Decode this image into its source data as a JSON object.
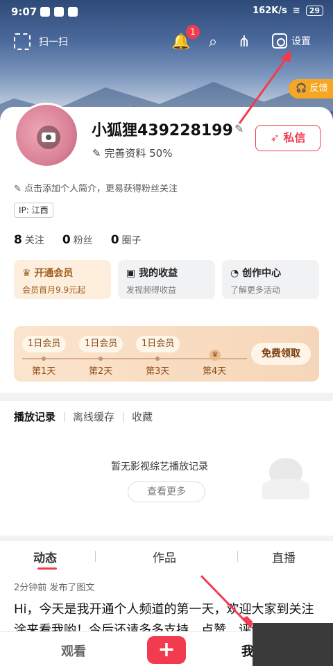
{
  "status_bar": {
    "time": "9:07",
    "network": "162K/s",
    "battery": "29"
  },
  "toolbar": {
    "scan_label": "扫一扫",
    "notification_count": "1",
    "settings_label": "设置"
  },
  "feedback_label": "反馈",
  "profile": {
    "username": "小狐狸439228199",
    "completion": "完善资料 50%",
    "bio_hint": "点击添加个人简介，更易获得粉丝关注",
    "ip": "IP: 江西",
    "message_button": "私信"
  },
  "stats": [
    {
      "count": "8",
      "label": "关注"
    },
    {
      "count": "0",
      "label": "粉丝"
    },
    {
      "count": "0",
      "label": "圈子"
    }
  ],
  "features": [
    {
      "title": "开通会员",
      "subtitle": "会员首月9.9元起"
    },
    {
      "title": "我的收益",
      "subtitle": "发视频得收益"
    },
    {
      "title": "创作中心",
      "subtitle": "了解更多活动"
    }
  ],
  "member_strip": {
    "pills": [
      "1日会员",
      "1日会员",
      "1日会员"
    ],
    "days": [
      "第1天",
      "第2天",
      "第3天",
      "第4天"
    ],
    "free_button": "免费领取"
  },
  "history": {
    "tabs": [
      "播放记录",
      "离线缓存",
      "收藏"
    ],
    "empty_text": "暂无影视综艺播放记录",
    "more_button": "查看更多"
  },
  "content_tabs": [
    "动态",
    "作品",
    "直播"
  ],
  "post": {
    "meta": "2分钟前 发布了图文",
    "text": "Hi，今天是我开通个人频道的第一天，欢迎大家到关注涂来看我哟！今后还请多多支持，点赞、评论、转"
  },
  "bottom_nav": {
    "left": "观看",
    "right": "我"
  },
  "colors": {
    "accent": "#f23b4e",
    "feedback": "#f5a623",
    "arrow": "#f23b4e"
  }
}
